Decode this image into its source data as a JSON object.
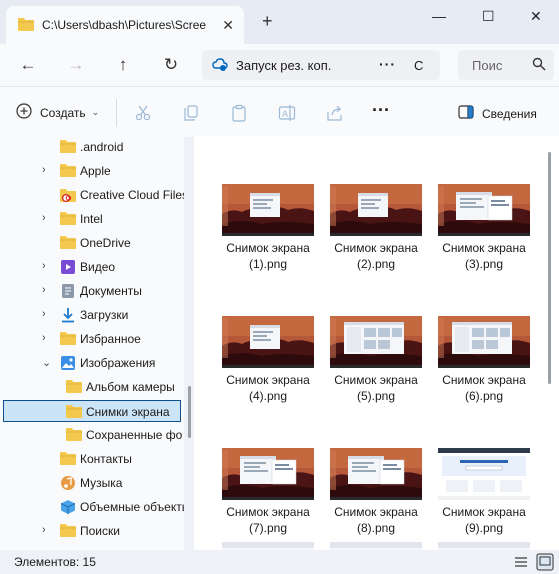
{
  "window": {
    "tab_title": "C:\\Users\\dbash\\Pictures\\Scree",
    "tab_close": "✕",
    "new_tab": "+",
    "min": "—",
    "max": "☐",
    "close": "✕"
  },
  "nav": {
    "back": "←",
    "forward": "→",
    "up": "↑",
    "refresh": "↻",
    "address_text": "Запуск рез. коп.",
    "more": "···",
    "crumb": "С",
    "search_placeholder": "Поис"
  },
  "toolbar": {
    "create_label": "Создать",
    "create_chevron": "⌄",
    "more": "···",
    "details_label": "Сведения"
  },
  "sidebar": {
    "items": [
      {
        "label": ".android",
        "icon": "folder-icon",
        "chevron": "",
        "indent": 1
      },
      {
        "label": "Apple",
        "icon": "folder-icon",
        "chevron": "›",
        "indent": 1
      },
      {
        "label": "Creative Cloud Files",
        "icon": "creative-cloud-icon",
        "chevron": "",
        "indent": 1
      },
      {
        "label": "Intel",
        "icon": "folder-icon",
        "chevron": "›",
        "indent": 1
      },
      {
        "label": "OneDrive",
        "icon": "folder-icon",
        "chevron": "",
        "indent": 1
      },
      {
        "label": "Видео",
        "icon": "video-icon",
        "chevron": "›",
        "indent": 1
      },
      {
        "label": "Документы",
        "icon": "documents-icon",
        "chevron": "›",
        "indent": 1
      },
      {
        "label": "Загрузки",
        "icon": "downloads-icon",
        "chevron": "›",
        "indent": 1
      },
      {
        "label": "Избранное",
        "icon": "folder-icon",
        "chevron": "›",
        "indent": 1
      },
      {
        "label": "Изображения",
        "icon": "pictures-icon",
        "chevron": "⌄",
        "indent": 1
      },
      {
        "label": "Альбом камеры",
        "icon": "folder-icon",
        "chevron": "",
        "indent": 2
      },
      {
        "label": "Снимки экрана",
        "icon": "folder-icon",
        "chevron": "",
        "indent": 2,
        "selected": true
      },
      {
        "label": "Сохраненные фо",
        "icon": "folder-icon",
        "chevron": "",
        "indent": 2
      },
      {
        "label": "Контакты",
        "icon": "folder-icon",
        "chevron": "",
        "indent": 1
      },
      {
        "label": "Музыка",
        "icon": "music-icon",
        "chevron": "",
        "indent": 1
      },
      {
        "label": "Объемные объекты",
        "icon": "3d-objects-icon",
        "chevron": "",
        "indent": 1
      },
      {
        "label": "Поиски",
        "icon": "folder-icon",
        "chevron": "›",
        "indent": 1
      }
    ]
  },
  "files": [
    {
      "line1": "Снимок экрана",
      "line2": "(1).png",
      "style": "a"
    },
    {
      "line1": "Снимок экрана",
      "line2": "(2).png",
      "style": "a"
    },
    {
      "line1": "Снимок экрана",
      "line2": "(3).png",
      "style": "b"
    },
    {
      "line1": "Снимок экрана",
      "line2": "(4).png",
      "style": "a"
    },
    {
      "line1": "Снимок экрана",
      "line2": "(5).png",
      "style": "c"
    },
    {
      "line1": "Снимок экрана",
      "line2": "(6).png",
      "style": "c"
    },
    {
      "line1": "Снимок экрана",
      "line2": "(7).png",
      "style": "b"
    },
    {
      "line1": "Снимок экрана",
      "line2": "(8).png",
      "style": "b"
    },
    {
      "line1": "Снимок экрана",
      "line2": "(9).png",
      "style": "web"
    },
    {
      "line1": "",
      "line2": "",
      "style": "partial"
    },
    {
      "line1": "",
      "line2": "",
      "style": "partial"
    },
    {
      "line1": "",
      "line2": "",
      "style": "partial"
    }
  ],
  "status": {
    "count_text": "Элементов: 15"
  },
  "colors": {
    "folder": "#f2c94c",
    "accent": "#0067c0",
    "selection_bg": "#cce4f7",
    "selection_border": "#0e4f8c"
  }
}
